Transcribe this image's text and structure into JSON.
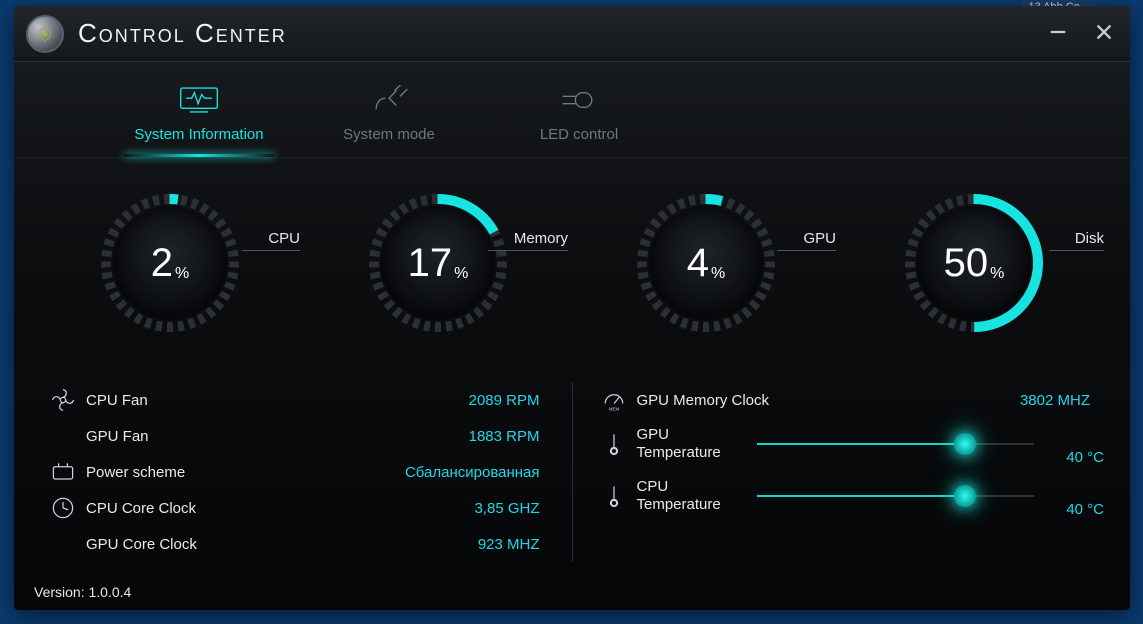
{
  "taskbar_item": "13 Abb Co...",
  "app": {
    "title": "Control Center"
  },
  "tabs": [
    {
      "id": "system-info",
      "label": "System Information",
      "active": true
    },
    {
      "id": "system-mode",
      "label": "System mode",
      "active": false
    },
    {
      "id": "led-control",
      "label": "LED control",
      "active": false
    }
  ],
  "gauges": {
    "cpu": {
      "label": "CPU",
      "value": 2,
      "pct_sign": "%"
    },
    "memory": {
      "label": "Memory",
      "value": 17,
      "pct_sign": "%"
    },
    "gpu": {
      "label": "GPU",
      "value": 4,
      "pct_sign": "%"
    },
    "disk": {
      "label": "Disk",
      "value": 50,
      "pct_sign": "%"
    }
  },
  "stats_left": {
    "cpu_fan": {
      "label": "CPU Fan",
      "value": "2089 RPM"
    },
    "gpu_fan": {
      "label": "GPU Fan",
      "value": "1883 RPM"
    },
    "power_scheme": {
      "label": "Power scheme",
      "value": "Сбалансированная"
    },
    "cpu_core_clock": {
      "label": "CPU Core Clock",
      "value": "3,85 GHZ"
    },
    "gpu_core_clock": {
      "label": "GPU Core Clock",
      "value": "923 MHZ"
    }
  },
  "stats_right": {
    "gpu_mem_clock": {
      "label": "GPU Memory Clock",
      "value": "3802 MHZ"
    },
    "gpu_temp": {
      "label": "GPU Temperature",
      "value": "40 °C",
      "slider_pct": 75
    },
    "cpu_temp": {
      "label": "CPU Temperature",
      "value": "40 °C",
      "slider_pct": 75
    }
  },
  "version_label": "Version: 1.0.0.4",
  "colors": {
    "accent": "#17e4e0",
    "value": "#1fd9e8"
  }
}
